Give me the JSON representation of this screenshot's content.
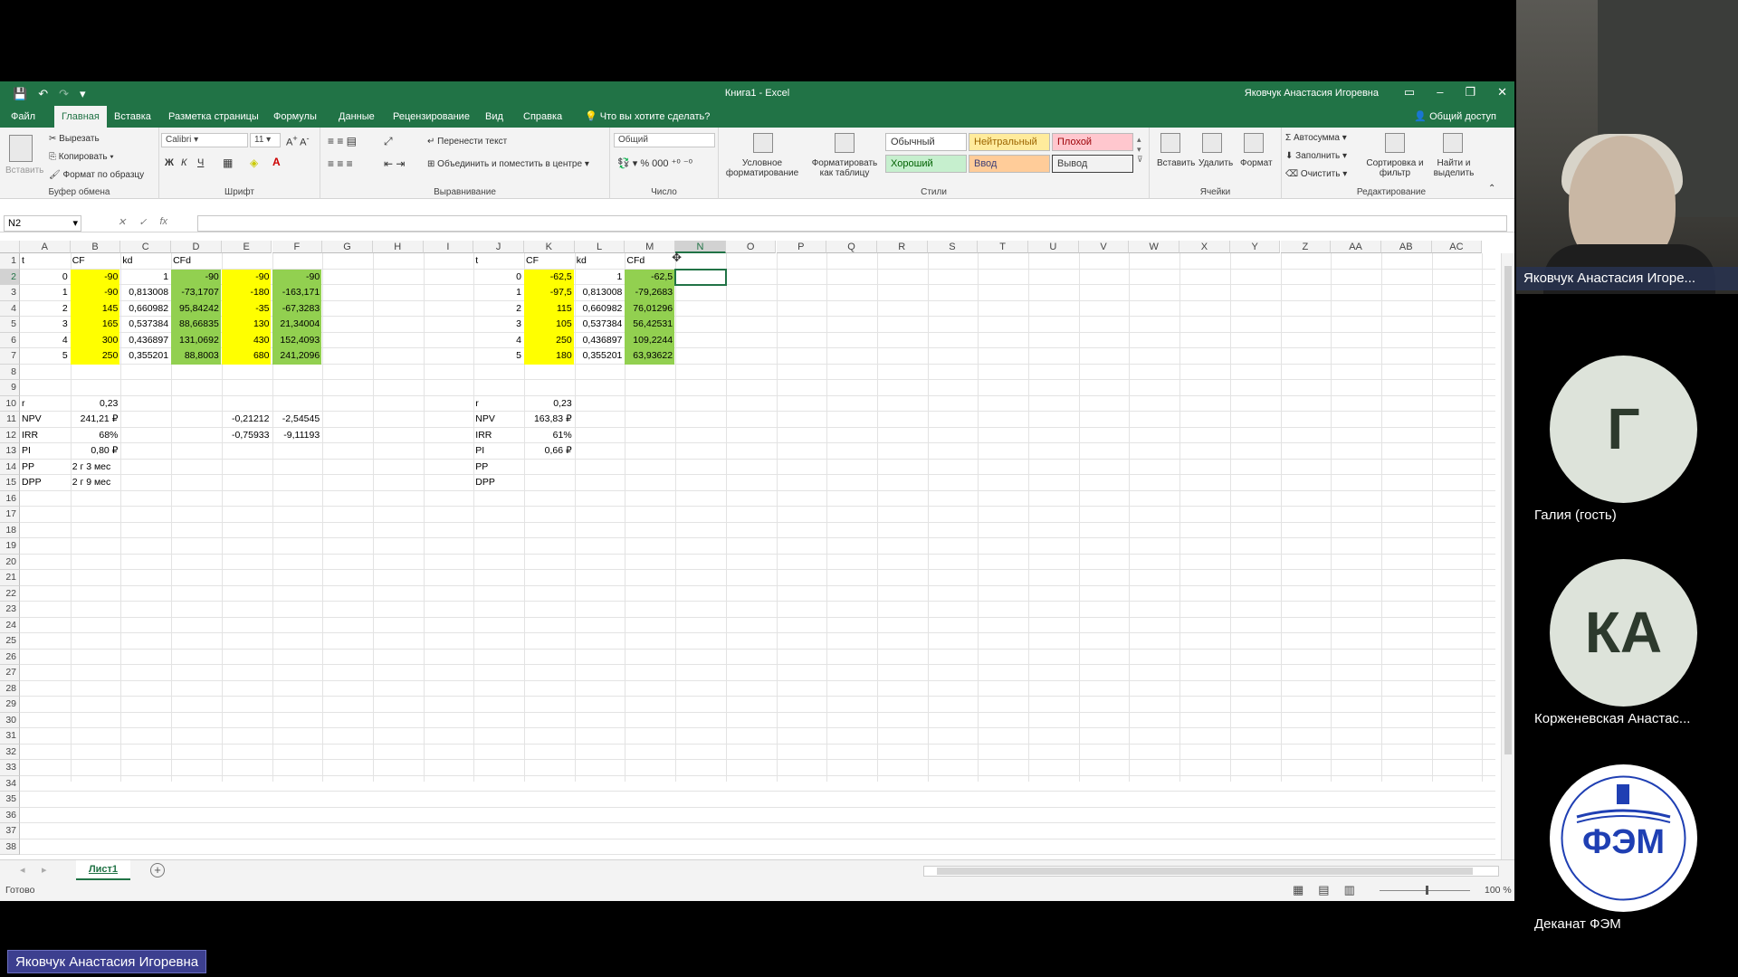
{
  "window": {
    "title": "Книга1  -  Excel",
    "user": "Яковчук Анастасия Игоревна"
  },
  "tabs": [
    "Файл",
    "Главная",
    "Вставка",
    "Разметка страницы",
    "Формулы",
    "Данные",
    "Рецензирование",
    "Вид",
    "Справка"
  ],
  "tell_me": "Что вы хотите сделать?",
  "share": "Общий доступ",
  "ribbon": {
    "clipboard": {
      "paste": "Вставить",
      "cut": "Вырезать",
      "copy": "Копировать",
      "format_painter": "Формат по образцу",
      "label": "Буфер обмена"
    },
    "font": {
      "name": "Calibri",
      "size": "11",
      "bold": "Ж",
      "italic": "К",
      "underline": "Ч",
      "label": "Шрифт"
    },
    "alignment": {
      "wrap": "Перенести текст",
      "merge": "Объединить и поместить в центре",
      "label": "Выравнивание"
    },
    "number": {
      "format": "Общий",
      "label": "Число"
    },
    "styles": {
      "conditional": "Условное форматирование",
      "as_table": "Форматировать как таблицу",
      "normal": "Обычный",
      "neutral": "Нейтральный",
      "bad": "Плохой",
      "good": "Хороший",
      "input": "Ввод",
      "output": "Вывод",
      "label": "Стили"
    },
    "cells": {
      "insert": "Вставить",
      "delete": "Удалить",
      "format": "Формат",
      "label": "Ячейки"
    },
    "editing": {
      "autosum": "Автосумма",
      "fill": "Заполнить",
      "clear": "Очистить",
      "sort": "Сортировка и фильтр",
      "find": "Найти и выделить",
      "label": "Редактирование"
    }
  },
  "name_box": "N2",
  "fx": "fx",
  "columns": [
    "A",
    "B",
    "C",
    "D",
    "E",
    "F",
    "G",
    "H",
    "I",
    "J",
    "K",
    "L",
    "M",
    "N",
    "O",
    "P",
    "Q",
    "R",
    "S",
    "T",
    "U",
    "V",
    "W",
    "X",
    "Y",
    "Z",
    "AA",
    "AB",
    "AC"
  ],
  "row_count": 38,
  "cells": [
    {
      "c": 0,
      "r": 1,
      "v": "t"
    },
    {
      "c": 1,
      "r": 1,
      "v": "CF"
    },
    {
      "c": 2,
      "r": 1,
      "v": "kd"
    },
    {
      "c": 3,
      "r": 1,
      "v": "CFd"
    },
    {
      "c": 0,
      "r": 2,
      "v": "0",
      "a": "r"
    },
    {
      "c": 1,
      "r": 2,
      "v": "-90",
      "a": "r",
      "f": "y"
    },
    {
      "c": 2,
      "r": 2,
      "v": "1",
      "a": "r"
    },
    {
      "c": 3,
      "r": 2,
      "v": "-90",
      "a": "r",
      "f": "g"
    },
    {
      "c": 4,
      "r": 2,
      "v": "-90",
      "a": "r",
      "f": "y"
    },
    {
      "c": 5,
      "r": 2,
      "v": "-90",
      "a": "r",
      "f": "g"
    },
    {
      "c": 0,
      "r": 3,
      "v": "1",
      "a": "r"
    },
    {
      "c": 1,
      "r": 3,
      "v": "-90",
      "a": "r",
      "f": "y"
    },
    {
      "c": 2,
      "r": 3,
      "v": "0,813008",
      "a": "r"
    },
    {
      "c": 3,
      "r": 3,
      "v": "-73,1707",
      "a": "r",
      "f": "g"
    },
    {
      "c": 4,
      "r": 3,
      "v": "-180",
      "a": "r",
      "f": "y"
    },
    {
      "c": 5,
      "r": 3,
      "v": "-163,171",
      "a": "r",
      "f": "g"
    },
    {
      "c": 0,
      "r": 4,
      "v": "2",
      "a": "r"
    },
    {
      "c": 1,
      "r": 4,
      "v": "145",
      "a": "r",
      "f": "y"
    },
    {
      "c": 2,
      "r": 4,
      "v": "0,660982",
      "a": "r"
    },
    {
      "c": 3,
      "r": 4,
      "v": "95,84242",
      "a": "r",
      "f": "g"
    },
    {
      "c": 4,
      "r": 4,
      "v": "-35",
      "a": "r",
      "f": "y"
    },
    {
      "c": 5,
      "r": 4,
      "v": "-67,3283",
      "a": "r",
      "f": "g"
    },
    {
      "c": 0,
      "r": 5,
      "v": "3",
      "a": "r"
    },
    {
      "c": 1,
      "r": 5,
      "v": "165",
      "a": "r",
      "f": "y"
    },
    {
      "c": 2,
      "r": 5,
      "v": "0,537384",
      "a": "r"
    },
    {
      "c": 3,
      "r": 5,
      "v": "88,66835",
      "a": "r",
      "f": "g"
    },
    {
      "c": 4,
      "r": 5,
      "v": "130",
      "a": "r",
      "f": "y"
    },
    {
      "c": 5,
      "r": 5,
      "v": "21,34004",
      "a": "r",
      "f": "g"
    },
    {
      "c": 0,
      "r": 6,
      "v": "4",
      "a": "r"
    },
    {
      "c": 1,
      "r": 6,
      "v": "300",
      "a": "r",
      "f": "y"
    },
    {
      "c": 2,
      "r": 6,
      "v": "0,436897",
      "a": "r"
    },
    {
      "c": 3,
      "r": 6,
      "v": "131,0692",
      "a": "r",
      "f": "g"
    },
    {
      "c": 4,
      "r": 6,
      "v": "430",
      "a": "r",
      "f": "y"
    },
    {
      "c": 5,
      "r": 6,
      "v": "152,4093",
      "a": "r",
      "f": "g"
    },
    {
      "c": 0,
      "r": 7,
      "v": "5",
      "a": "r"
    },
    {
      "c": 1,
      "r": 7,
      "v": "250",
      "a": "r",
      "f": "y"
    },
    {
      "c": 2,
      "r": 7,
      "v": "0,355201",
      "a": "r"
    },
    {
      "c": 3,
      "r": 7,
      "v": "88,8003",
      "a": "r",
      "f": "g"
    },
    {
      "c": 4,
      "r": 7,
      "v": "680",
      "a": "r",
      "f": "y"
    },
    {
      "c": 5,
      "r": 7,
      "v": "241,2096",
      "a": "r",
      "f": "g"
    },
    {
      "c": 0,
      "r": 10,
      "v": "r"
    },
    {
      "c": 1,
      "r": 10,
      "v": "0,23",
      "a": "r"
    },
    {
      "c": 0,
      "r": 11,
      "v": "NPV"
    },
    {
      "c": 1,
      "r": 11,
      "v": "241,21 ₽",
      "a": "r"
    },
    {
      "c": 4,
      "r": 11,
      "v": "-0,21212",
      "a": "r"
    },
    {
      "c": 5,
      "r": 11,
      "v": "-2,54545",
      "a": "r"
    },
    {
      "c": 0,
      "r": 12,
      "v": "IRR"
    },
    {
      "c": 1,
      "r": 12,
      "v": "68%",
      "a": "r"
    },
    {
      "c": 4,
      "r": 12,
      "v": "-0,75933",
      "a": "r"
    },
    {
      "c": 5,
      "r": 12,
      "v": "-9,11193",
      "a": "r"
    },
    {
      "c": 0,
      "r": 13,
      "v": "PI"
    },
    {
      "c": 1,
      "r": 13,
      "v": "0,80 ₽",
      "a": "r"
    },
    {
      "c": 0,
      "r": 14,
      "v": "PP"
    },
    {
      "c": 1,
      "r": 14,
      "v": "2 г 3 мес"
    },
    {
      "c": 0,
      "r": 15,
      "v": "DPP"
    },
    {
      "c": 1,
      "r": 15,
      "v": "2 г 9 мес"
    },
    {
      "c": 9,
      "r": 1,
      "v": "t"
    },
    {
      "c": 10,
      "r": 1,
      "v": "CF"
    },
    {
      "c": 11,
      "r": 1,
      "v": "kd"
    },
    {
      "c": 12,
      "r": 1,
      "v": "CFd"
    },
    {
      "c": 9,
      "r": 2,
      "v": "0",
      "a": "r"
    },
    {
      "c": 10,
      "r": 2,
      "v": "-62,5",
      "a": "r",
      "f": "y"
    },
    {
      "c": 11,
      "r": 2,
      "v": "1",
      "a": "r"
    },
    {
      "c": 12,
      "r": 2,
      "v": "-62,5",
      "a": "r",
      "f": "g"
    },
    {
      "c": 9,
      "r": 3,
      "v": "1",
      "a": "r"
    },
    {
      "c": 10,
      "r": 3,
      "v": "-97,5",
      "a": "r",
      "f": "y"
    },
    {
      "c": 11,
      "r": 3,
      "v": "0,813008",
      "a": "r"
    },
    {
      "c": 12,
      "r": 3,
      "v": "-79,2683",
      "a": "r",
      "f": "g"
    },
    {
      "c": 9,
      "r": 4,
      "v": "2",
      "a": "r"
    },
    {
      "c": 10,
      "r": 4,
      "v": "115",
      "a": "r",
      "f": "y"
    },
    {
      "c": 11,
      "r": 4,
      "v": "0,660982",
      "a": "r"
    },
    {
      "c": 12,
      "r": 4,
      "v": "76,01296",
      "a": "r",
      "f": "g"
    },
    {
      "c": 9,
      "r": 5,
      "v": "3",
      "a": "r"
    },
    {
      "c": 10,
      "r": 5,
      "v": "105",
      "a": "r",
      "f": "y"
    },
    {
      "c": 11,
      "r": 5,
      "v": "0,537384",
      "a": "r"
    },
    {
      "c": 12,
      "r": 5,
      "v": "56,42531",
      "a": "r",
      "f": "g"
    },
    {
      "c": 9,
      "r": 6,
      "v": "4",
      "a": "r"
    },
    {
      "c": 10,
      "r": 6,
      "v": "250",
      "a": "r",
      "f": "y"
    },
    {
      "c": 11,
      "r": 6,
      "v": "0,436897",
      "a": "r"
    },
    {
      "c": 12,
      "r": 6,
      "v": "109,2244",
      "a": "r",
      "f": "g"
    },
    {
      "c": 9,
      "r": 7,
      "v": "5",
      "a": "r"
    },
    {
      "c": 10,
      "r": 7,
      "v": "180",
      "a": "r",
      "f": "y"
    },
    {
      "c": 11,
      "r": 7,
      "v": "0,355201",
      "a": "r"
    },
    {
      "c": 12,
      "r": 7,
      "v": "63,93622",
      "a": "r",
      "f": "g"
    },
    {
      "c": 9,
      "r": 10,
      "v": "r"
    },
    {
      "c": 10,
      "r": 10,
      "v": "0,23",
      "a": "r"
    },
    {
      "c": 9,
      "r": 11,
      "v": "NPV"
    },
    {
      "c": 10,
      "r": 11,
      "v": "163,83 ₽",
      "a": "r"
    },
    {
      "c": 9,
      "r": 12,
      "v": "IRR"
    },
    {
      "c": 10,
      "r": 12,
      "v": "61%",
      "a": "r"
    },
    {
      "c": 9,
      "r": 13,
      "v": "PI"
    },
    {
      "c": 10,
      "r": 13,
      "v": "0,66 ₽",
      "a": "r"
    },
    {
      "c": 9,
      "r": 14,
      "v": "PP"
    },
    {
      "c": 9,
      "r": 15,
      "v": "DPP"
    }
  ],
  "sheet_tab": "Лист1",
  "status": {
    "ready": "Готово",
    "zoom": "100 %"
  },
  "participants": {
    "speaker": "Яковчук Анастасия Игоре...",
    "p1": {
      "initial": "Г",
      "name": "Галия (гость)"
    },
    "p2": {
      "initial": "КА",
      "name": "Корженевская Анастас..."
    },
    "p3": {
      "name": "Деканат ФЭМ",
      "logo_text": "ФЭМ"
    },
    "self_name": "Яковчук Анастасия Игоревна"
  },
  "colors": {
    "excel_green": "#217346",
    "yellow": "#ffff00",
    "green": "#92d050"
  }
}
